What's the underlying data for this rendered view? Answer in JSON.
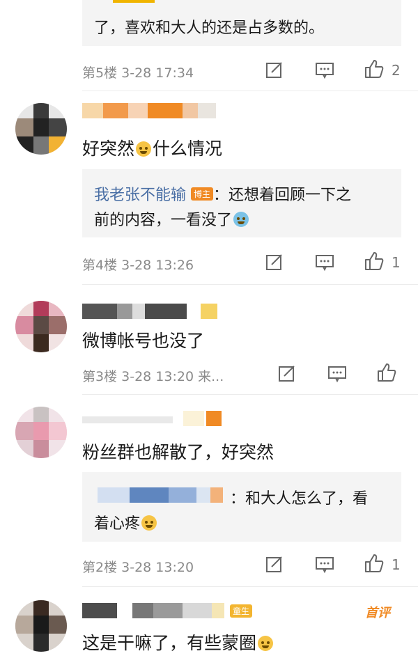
{
  "comments": [
    {
      "text": "了，喜欢和大人的还是占多数的。",
      "floor": "第5楼",
      "time": "3-28 17:34",
      "likes": "2"
    },
    {
      "text_before": "好突然",
      "text_after": "什么情况",
      "reply": {
        "author": "我老张不能输",
        "author_badge": "博主",
        "text_line1": "：还想着回顾一下之",
        "text_line2": "前的内容，一看没了"
      },
      "floor": "第4楼",
      "time": "3-28 13:26",
      "likes": "1"
    },
    {
      "text": "微博帐号也没了",
      "floor": "第3楼",
      "time": "3-28 13:20",
      "more": "来..."
    },
    {
      "text": "粉丝群也解散了，好突然",
      "reply": {
        "badge": "主",
        "text_line1": "：和大人怎么了，看",
        "text_line2": "着心疼"
      },
      "floor": "第2楼",
      "time": "3-28 13:20",
      "likes": "1"
    },
    {
      "text": "这是干嘛了，有些蒙圈",
      "badge": "童生",
      "top_comment": "首评"
    }
  ],
  "icons": {
    "edit": "edit-icon",
    "comment": "comment-icon",
    "like": "thumbs-up-icon",
    "emoji": "emoji-icon"
  },
  "colors": {
    "link_blue": "#4a6fa5",
    "badge_orange": "#f08a24",
    "meta_gray": "#8a8a8a",
    "quote_bg": "#f4f4f4"
  }
}
